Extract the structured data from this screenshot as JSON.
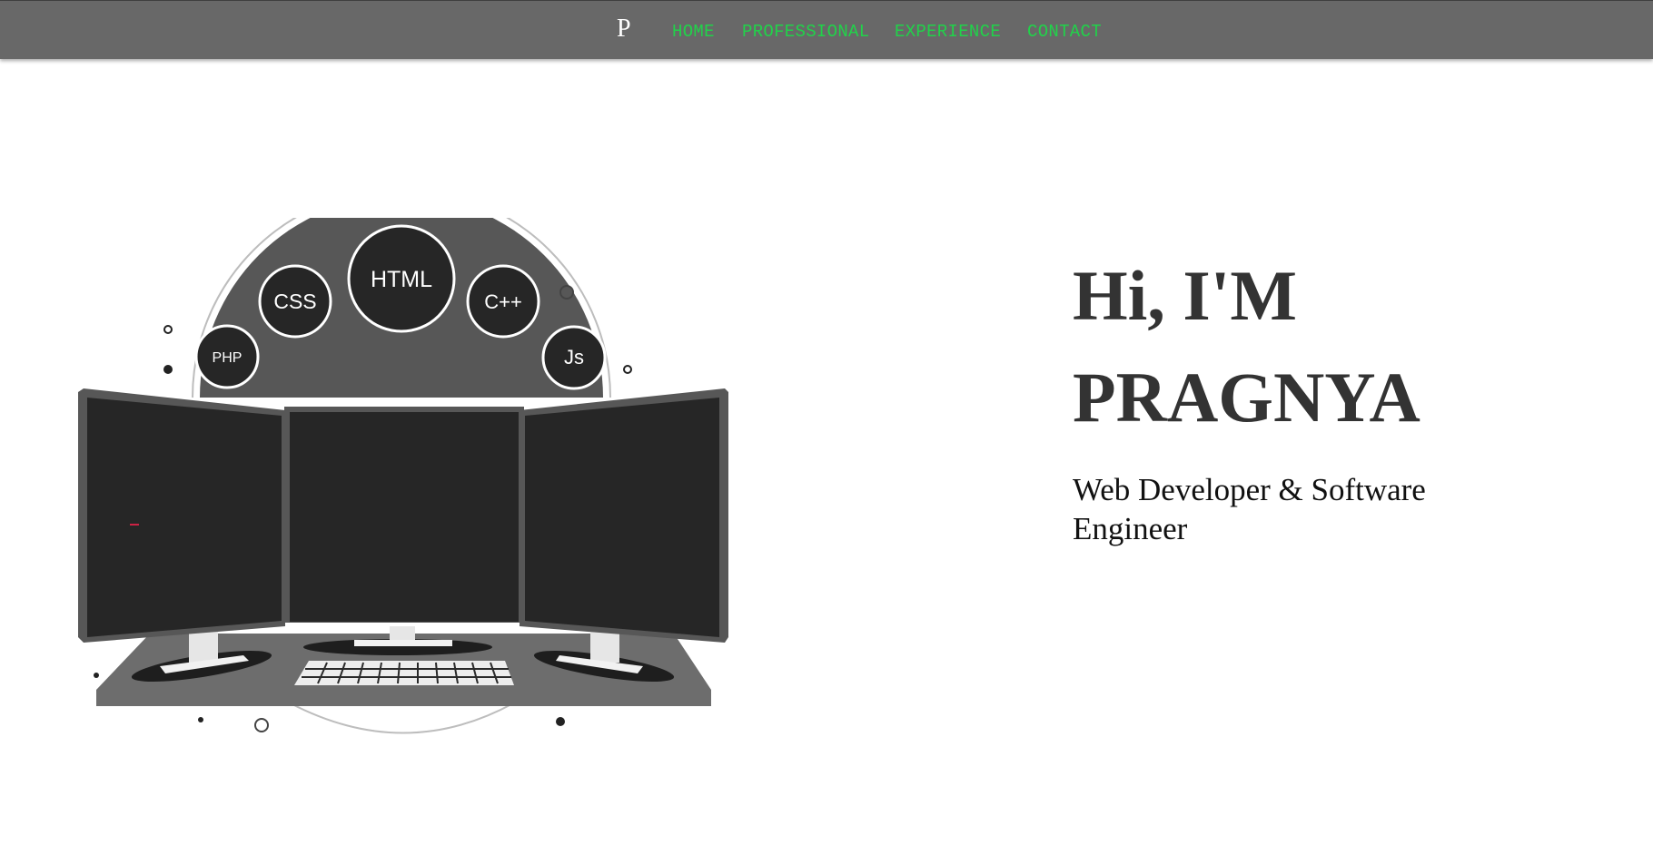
{
  "nav": {
    "logo": "P",
    "links": [
      "HOME",
      "PROFESSIONAL",
      "EXPERIENCE",
      "CONTACT"
    ]
  },
  "hero": {
    "greeting": "Hi, I'M",
    "name": "PRAGNYA",
    "subtitle": "Web Developer & Software Engineer",
    "illustration": {
      "bubbles": [
        "PHP",
        "CSS",
        "HTML",
        "C++",
        "Js"
      ]
    }
  },
  "colors": {
    "navbar_bg": "#686868",
    "nav_link": "#21d24a",
    "heading": "#333333"
  }
}
